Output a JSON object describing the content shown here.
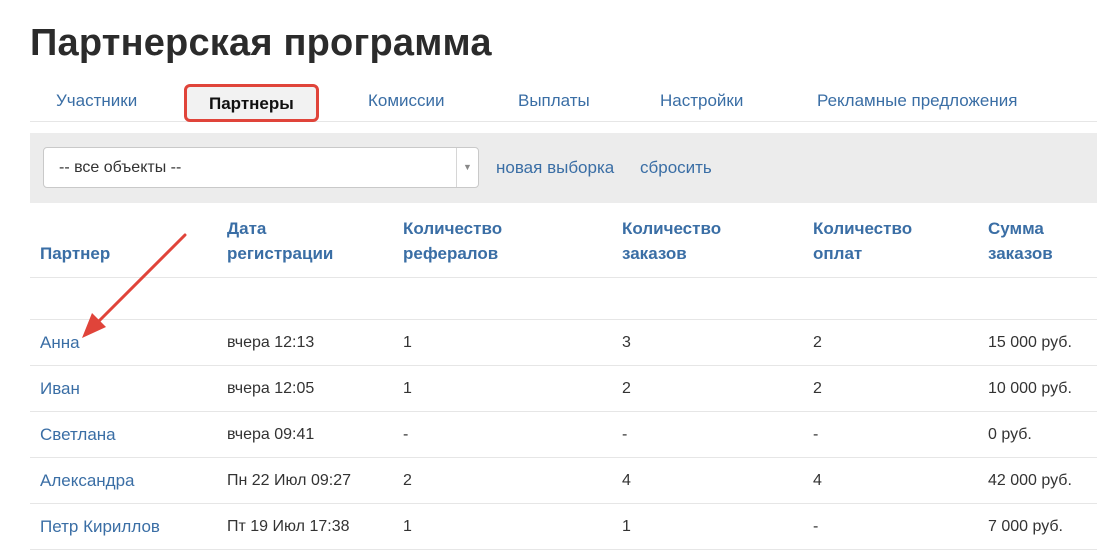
{
  "page_title": "Партнерская программа",
  "tabs": [
    {
      "label": "Участники",
      "active": false
    },
    {
      "label": "Партнеры",
      "active": true
    },
    {
      "label": "Комиссии",
      "active": false
    },
    {
      "label": "Выплаты",
      "active": false
    },
    {
      "label": "Настройки",
      "active": false
    },
    {
      "label": "Рекламные предложения",
      "active": false
    }
  ],
  "filter": {
    "select_value": "-- все объекты --",
    "new_selection_link": "новая выборка",
    "reset_link": "сбросить"
  },
  "table": {
    "headers": [
      {
        "line1": "",
        "line2": "Партнер"
      },
      {
        "line1": "Дата",
        "line2": "регистрации"
      },
      {
        "line1": "Количество",
        "line2": "рефералов"
      },
      {
        "line1": "Количество",
        "line2": "заказов"
      },
      {
        "line1": "Количество",
        "line2": "оплат"
      },
      {
        "line1": "Сумма",
        "line2": "заказов"
      }
    ],
    "rows": [
      [
        "Анна",
        "вчера 12:13",
        "1",
        "3",
        "2",
        "15 000 руб."
      ],
      [
        "Иван",
        "вчера 12:05",
        "1",
        "2",
        "2",
        "10 000 руб."
      ],
      [
        "Светлана",
        "вчера 09:41",
        "-",
        "-",
        "-",
        "0 руб."
      ],
      [
        "Александра",
        "Пн 22 Июл 09:27",
        "2",
        "4",
        "4",
        "42 000 руб."
      ],
      [
        "Петр Кириллов",
        "Пт 19 Июл 17:38",
        "1",
        "1",
        "-",
        "7 000 руб."
      ]
    ]
  },
  "annotation": {
    "arrow_color": "#e0443a",
    "highlight_color": "#e0443a"
  }
}
